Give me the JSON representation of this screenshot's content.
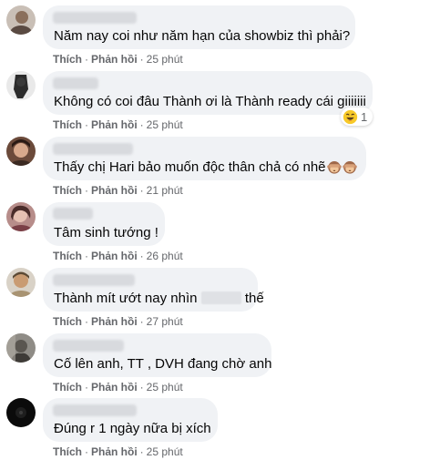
{
  "comments": [
    {
      "text": "Năm nay coi như năm hạn của showbiz thì phải?",
      "like": "Thích",
      "reply": "Phản hồi",
      "sep": "·",
      "time": "25 phút"
    },
    {
      "text": "Không có coi đâu Thành ơi là Thành ready cái giiiiiii",
      "like": "Thích",
      "reply": "Phản hồi",
      "sep": "·",
      "time": "25 phút",
      "reaction": {
        "icon": "laughing-emoji",
        "count": "1"
      }
    },
    {
      "text": "Thấy chị Hari bảo muốn độc thân chả có nhẽ",
      "emojis": [
        "see-no-evil-monkey",
        "see-no-evil-monkey"
      ],
      "like": "Thích",
      "reply": "Phản hồi",
      "sep": "·",
      "time": "21 phút"
    },
    {
      "text": "Tâm sinh tướng !",
      "like": "Thích",
      "reply": "Phản hồi",
      "sep": "·",
      "time": "26 phút"
    },
    {
      "text_before": "Thành mít ướt nay nhìn",
      "text_after": "thế",
      "like": "Thích",
      "reply": "Phản hồi",
      "sep": "·",
      "time": "27 phút"
    },
    {
      "text": "Cố lên anh, TT , DVH đang chờ anh",
      "like": "Thích",
      "reply": "Phản hồi",
      "sep": "·",
      "time": "25 phút"
    },
    {
      "text": "Đúng r 1 ngày nữa bị xích",
      "like": "Thích",
      "reply": "Phản hồi",
      "sep": "·",
      "time": "25 phút"
    }
  ],
  "colors": {
    "bubble": "#f0f2f5",
    "text": "#050505",
    "meta": "#65676b"
  }
}
